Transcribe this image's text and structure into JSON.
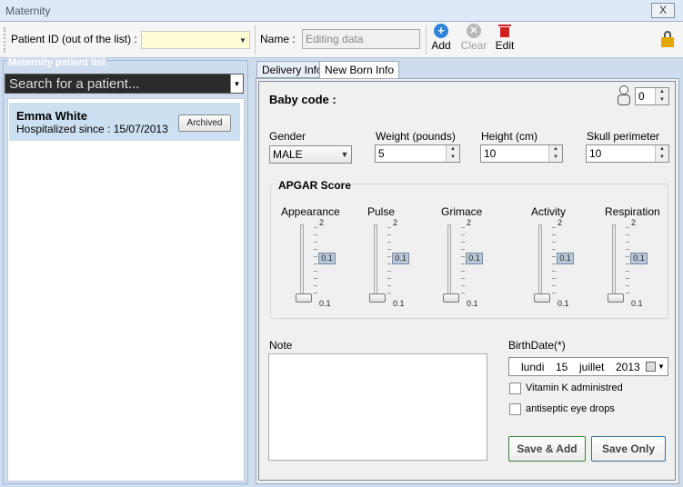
{
  "window": {
    "title": "Maternity",
    "close_label": "X"
  },
  "toolbar": {
    "patient_id_label": "Patient ID (out of the list) :",
    "patient_id_value": "",
    "name_label": "Name :",
    "name_placeholder": "Editing data",
    "add_label": "Add",
    "clear_label": "Clear",
    "edit_label": "Edit",
    "add_icon": "plus-circle-icon",
    "clear_icon": "x-circle-icon",
    "edit_icon": "trash-icon",
    "lock_icon": "lock-icon"
  },
  "left_panel": {
    "title": "Maternity patient list",
    "search_placeholder": "Search for a patient...",
    "patients": [
      {
        "name": "Emma White",
        "hospitalized": "Hospitalized since : 15/07/2013",
        "status": "Archived"
      }
    ]
  },
  "tabs": [
    {
      "label": "Delivery Info",
      "active": false
    },
    {
      "label": "New Born Info",
      "active": true
    }
  ],
  "newborn": {
    "baby_code_label": "Baby code :",
    "baby_code_value": "0",
    "gender_label": "Gender",
    "gender_value": "MALE",
    "weight_label": "Weight (pounds)",
    "weight_value": "5",
    "height_label": "Height (cm)",
    "height_value": "10",
    "skull_label": "Skull perimeter",
    "skull_value": "10"
  },
  "apgar": {
    "title": "APGAR Score",
    "max_label": "2",
    "min_label": "0.1",
    "sliders": [
      {
        "label": "Appearance",
        "value": "0.1"
      },
      {
        "label": "Pulse",
        "value": "0.1"
      },
      {
        "label": "Grimace",
        "value": "0.1"
      },
      {
        "label": "Activity",
        "value": "0.1"
      },
      {
        "label": "Respiration",
        "value": "0.1"
      }
    ]
  },
  "note": {
    "label": "Note",
    "value": ""
  },
  "birthdate": {
    "label": "BirthDate(*)",
    "day_name": "lundi",
    "day": "15",
    "month": "juillet",
    "year": "2013"
  },
  "checks": {
    "vitamin_k": "Vitamin K administred",
    "eye_drops": "antiseptic eye drops"
  },
  "actions": {
    "save_add": "Save & Add",
    "save_only": "Save Only"
  },
  "colors": {
    "accent_green": "#3a7a3a",
    "accent_blue": "#3a6a9a",
    "add_blue": "#2f86d8",
    "delete_red": "#d02020",
    "lock_gold": "#d4a000"
  }
}
